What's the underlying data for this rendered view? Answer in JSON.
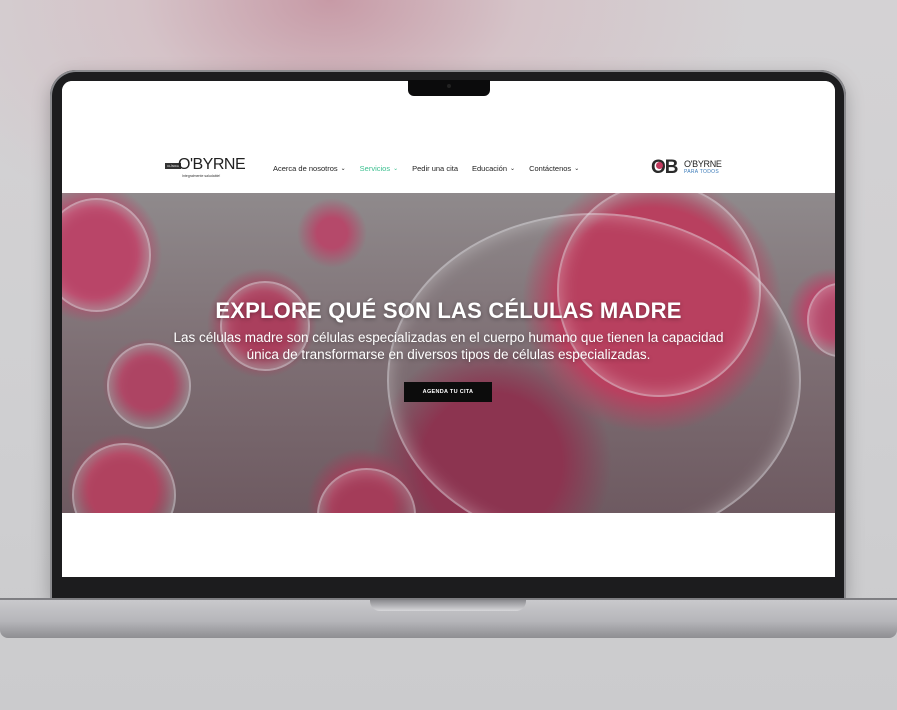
{
  "header": {
    "logo_left": {
      "badge": "CLÍNICA",
      "name": "O'BYRNE",
      "tagline": "Integralmente saludable!"
    },
    "nav": [
      {
        "label": "Acerca de nosotros",
        "dropdown": true,
        "active": false
      },
      {
        "label": "Servicios",
        "dropdown": true,
        "active": true
      },
      {
        "label": "Pedir una cita",
        "dropdown": false,
        "active": false
      },
      {
        "label": "Educación",
        "dropdown": true,
        "active": false
      },
      {
        "label": "Contáctenos",
        "dropdown": true,
        "active": false
      }
    ],
    "logo_right": {
      "mark": "OB",
      "name": "O'BYRNE",
      "sub": "PARA TODOS"
    },
    "active_color": "#3bbf8f"
  },
  "hero": {
    "title": "EXPLORE QUÉ SON LAS CÉLULAS MADRE",
    "subtitle": "Las células madre son células especializadas en el cuerpo humano que tienen la capacidad única de transformarse en diversos tipos de células especializadas.",
    "cta_label": "AGENDA TU CITA",
    "accent": "#b8405f"
  },
  "icons": {
    "dropdown": "chevron-down-icon"
  }
}
